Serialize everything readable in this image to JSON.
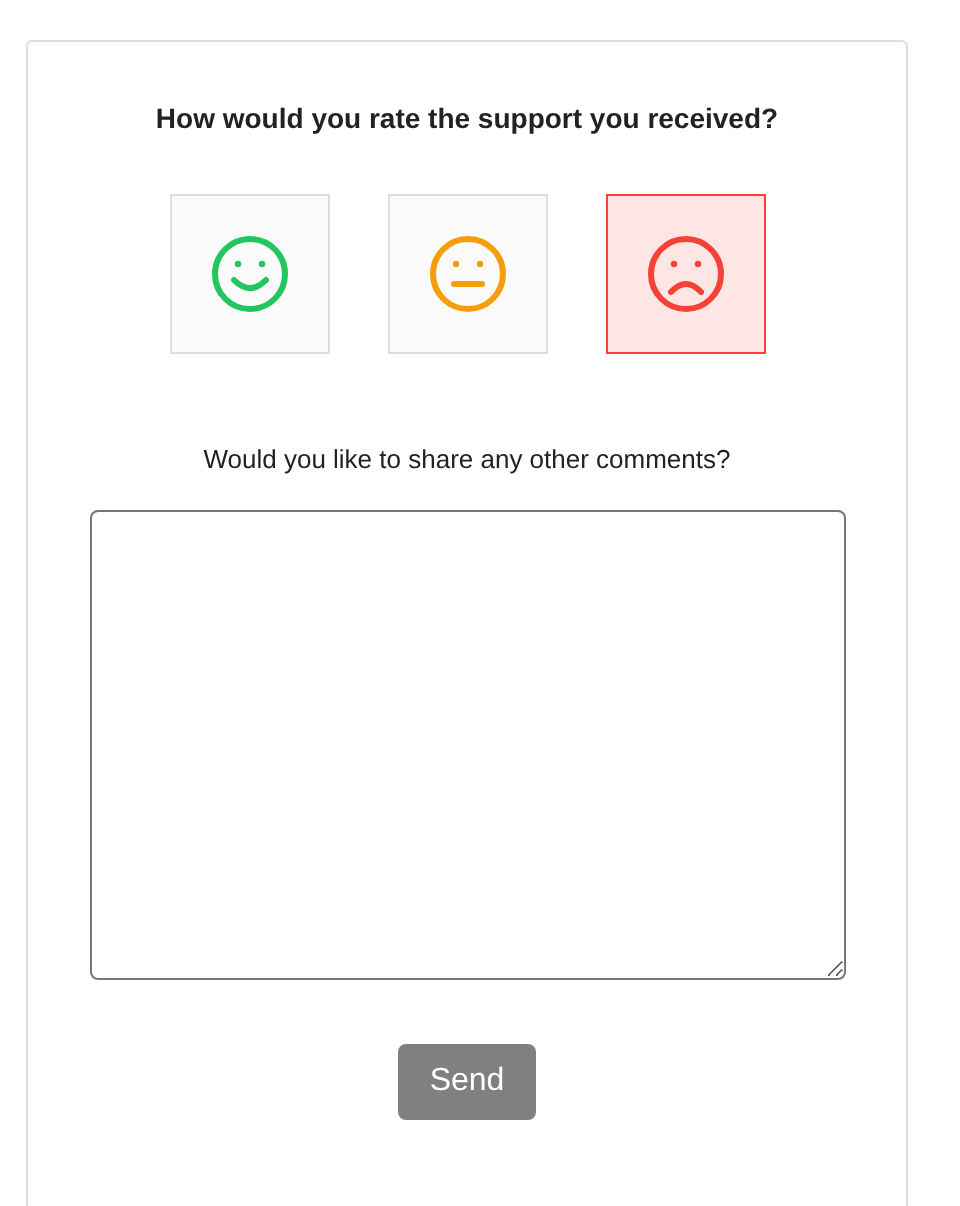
{
  "question": "How would you rate the support you received?",
  "ratings": [
    {
      "kind": "happy",
      "color": "#22c55e",
      "selected": false
    },
    {
      "kind": "neutral",
      "color": "#f59e0b",
      "selected": false
    },
    {
      "kind": "sad",
      "color": "#f44336",
      "selected": true
    }
  ],
  "comments": {
    "label": "Would you like to share any other comments?"
  },
  "send_button": {
    "label": "Send",
    "disabled": true
  }
}
